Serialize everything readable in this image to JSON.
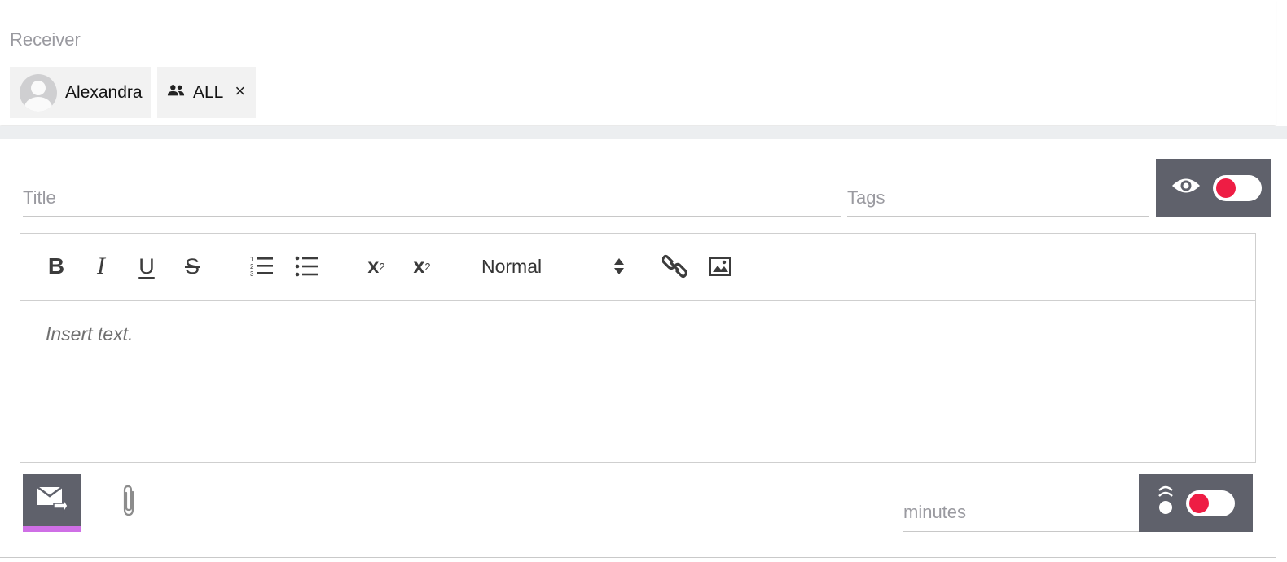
{
  "receiver": {
    "placeholder": "Receiver",
    "chips": [
      {
        "label": "Alexandra",
        "icon": "avatar"
      },
      {
        "label": "ALL",
        "icon": "group-icon",
        "close": "×"
      }
    ]
  },
  "compose": {
    "title_placeholder": "Title",
    "tags_placeholder": "Tags",
    "visibility_toggle": {
      "icon": "eye-icon",
      "state": "off"
    },
    "toolbar": {
      "bold": "B",
      "italic": "I",
      "underline": "U",
      "strike": "S",
      "subscript": {
        "base": "x",
        "index": "2"
      },
      "superscript": {
        "base": "x",
        "index": "2"
      },
      "header_select": "Normal"
    },
    "editor_placeholder": "Insert text.",
    "minutes_placeholder": "minutes",
    "priority_toggle": {
      "icon": "priority-icon",
      "state": "off"
    }
  },
  "colors": {
    "panel": "#5f616b",
    "toggle_knob": "#ee1d44",
    "send_accent": "#cf6fe6",
    "placeholder": "#9a9aa0"
  }
}
